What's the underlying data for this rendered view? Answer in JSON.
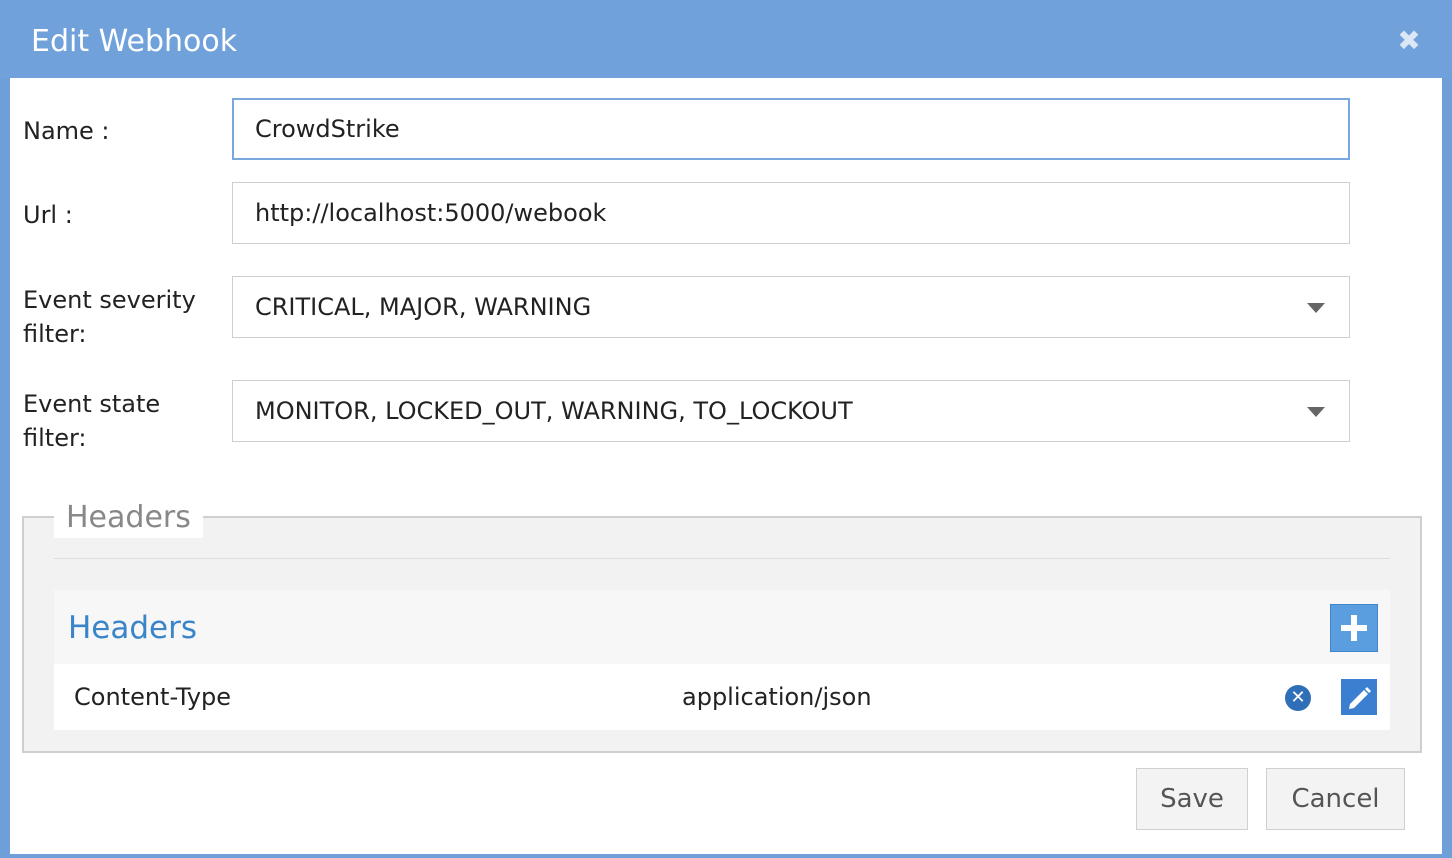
{
  "dialog": {
    "title": "Edit Webhook",
    "close_icon": "✖"
  },
  "form": {
    "name": {
      "label": "Name :",
      "value": "CrowdStrike"
    },
    "url": {
      "label": "Url :",
      "value": "http://localhost:5000/webook"
    },
    "severity": {
      "label_line1": "Event severity",
      "label_line2": "filter:",
      "value": "CRITICAL, MAJOR, WARNING"
    },
    "state": {
      "label_line1": "Event state",
      "label_line2": "filter:",
      "value": "MONITOR, LOCKED_OUT, WARNING, TO_LOCKOUT"
    }
  },
  "headers_section": {
    "legend": "Headers",
    "panel_title": "Headers",
    "rows": [
      {
        "key": "Content-Type",
        "value": "application/json"
      }
    ],
    "delete_icon": "✕"
  },
  "buttons": {
    "save": "Save",
    "cancel": "Cancel"
  },
  "colors": {
    "titlebar": "#70a1da",
    "accent": "#3a84c9"
  }
}
